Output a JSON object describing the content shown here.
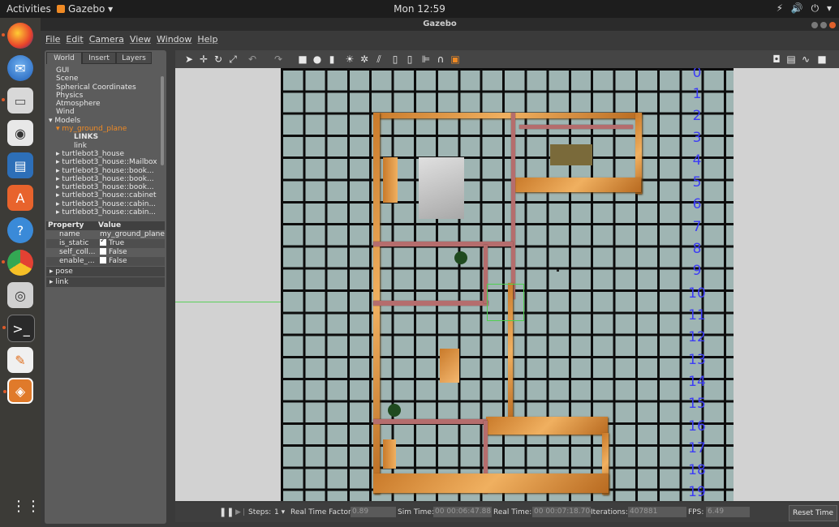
{
  "topbar": {
    "activities": "Activities",
    "app_name": "Gazebo ▾",
    "clock": "Mon 12:59",
    "tray": "⚡ 🔊 ⏻ ▾"
  },
  "window": {
    "title": "Gazebo"
  },
  "menu": [
    "File",
    "Edit",
    "Camera",
    "View",
    "Window",
    "Help"
  ],
  "tabs": [
    "World",
    "Insert",
    "Layers"
  ],
  "tree": {
    "items": [
      "GUI",
      "Scene",
      "Spherical Coordinates",
      "Physics",
      "Atmosphere",
      "Wind"
    ],
    "models_label": "▾ Models",
    "selected_model": "▾ my_ground_plane",
    "links_label": "LINKS",
    "link_label": "link",
    "models": [
      "▸ turtlebot3_house",
      "▸ turtlebot3_house::Mailbox",
      "▸ turtlebot3_house::book...",
      "▸ turtlebot3_house::book...",
      "▸ turtlebot3_house::book...",
      "▸ turtlebot3_house::cabinet",
      "▸ turtlebot3_house::cabin...",
      "▸ turtlebot3_house::cabin..."
    ]
  },
  "properties": {
    "header_key": "Property",
    "header_value": "Value",
    "rows": [
      {
        "key": "name",
        "value": "my_ground_plane"
      },
      {
        "key": "is_static",
        "value": "True"
      },
      {
        "key": "self_coll...",
        "value": "False"
      },
      {
        "key": "enable_...",
        "value": "False"
      }
    ],
    "sections": [
      "▸ pose",
      "▸ link"
    ]
  },
  "grid_labels": [
    "0",
    "1",
    "2",
    "3",
    "4",
    "5",
    "6",
    "7",
    "8",
    "9",
    "10",
    "11",
    "12",
    "13",
    "14",
    "15",
    "16",
    "17",
    "18",
    "19"
  ],
  "status": {
    "pause": "❚❚",
    "step_icon": "▶❘",
    "steps_label": "Steps:",
    "steps_value": "1 ▾",
    "rtf_label": "Real Time Factor:",
    "rtf_value": "0.89",
    "sim_label": "Sim Time:",
    "sim_value": "00 00:06:47.881",
    "real_label": "Real Time:",
    "real_value": "00 00:07:18.704",
    "iter_label": "Iterations:",
    "iter_value": "407881",
    "fps_label": "FPS:",
    "fps_value": "6.49",
    "reset": "Reset Time"
  }
}
